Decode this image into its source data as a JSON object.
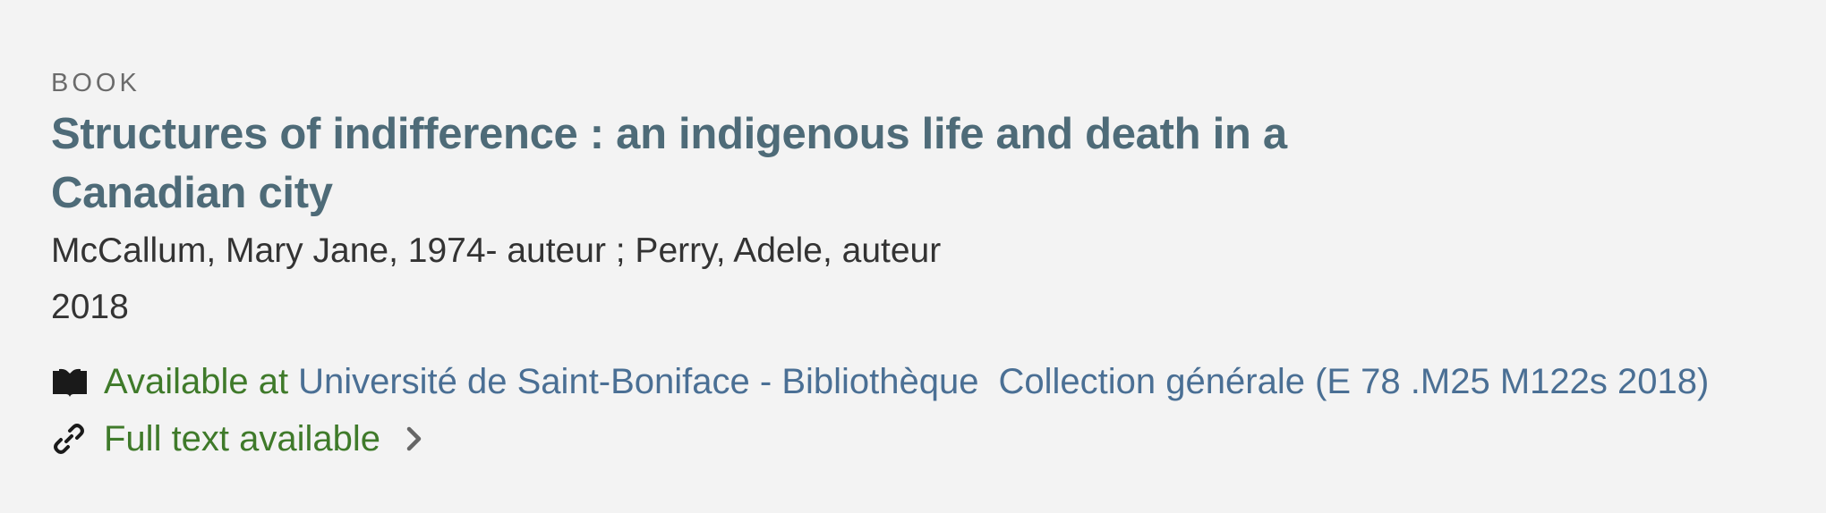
{
  "record": {
    "type": "BOOK",
    "title": "Structures of indifference : an indigenous life and death in a Canadian city",
    "authors": "McCallum, Mary Jane, 1974- auteur ; Perry, Adele, auteur",
    "year": "2018"
  },
  "availability": {
    "icon": "open-book-icon",
    "status": "Available at",
    "location": "Université de Saint-Boniface - Bibliothèque",
    "collection": "Collection générale (E 78 .M25 M122s 2018)"
  },
  "fulltext": {
    "icon": "link-icon",
    "label": "Full text available",
    "arrow_icon": "chevron-right-icon"
  },
  "colors": {
    "background": "#f3f3f3",
    "title": "#4e6b78",
    "available": "#3f7a2a",
    "link": "#4a6f94",
    "type_label": "#6b6b6b",
    "text": "#333333"
  }
}
